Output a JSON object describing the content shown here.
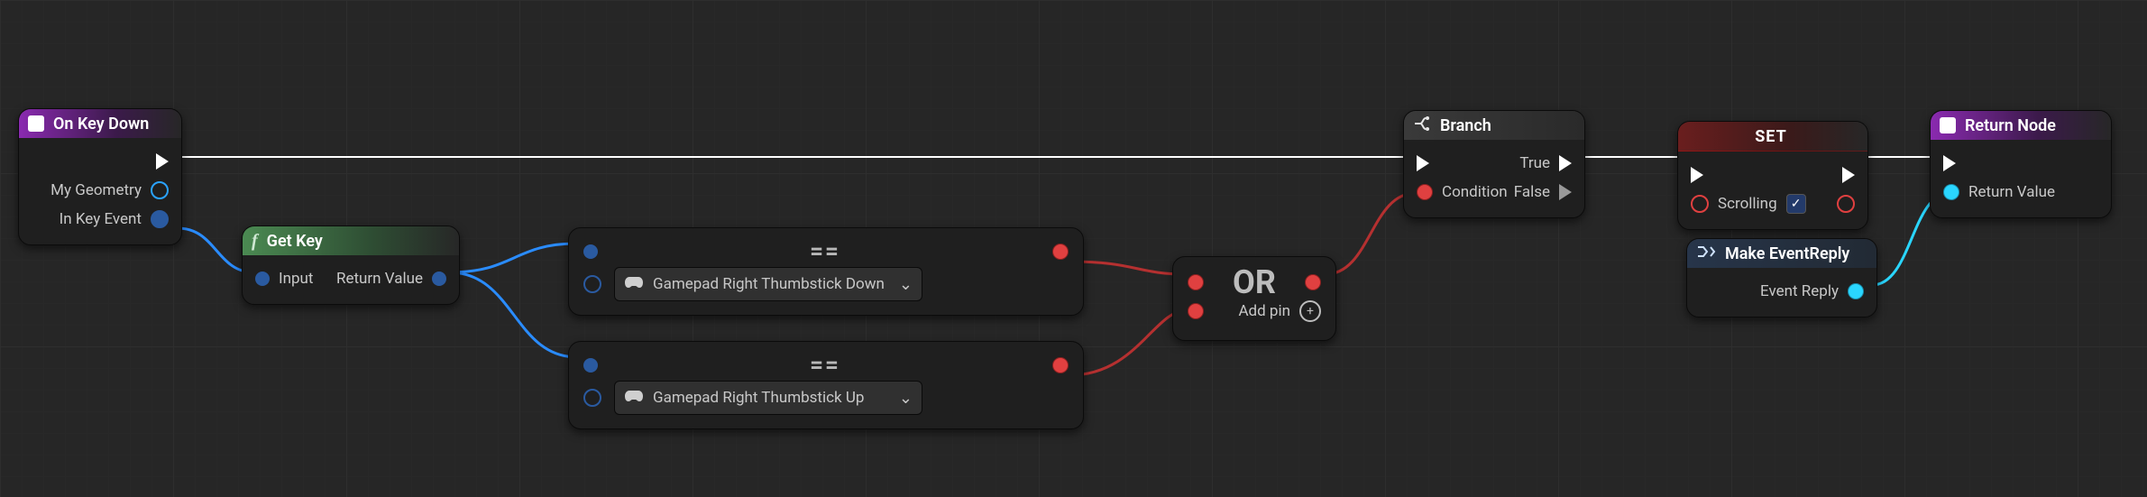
{
  "nodes": {
    "event": {
      "title": "On Key Down",
      "pins": {
        "my_geometry": "My Geometry",
        "in_key_event": "In Key Event"
      }
    },
    "getkey": {
      "title": "Get Key",
      "pins": {
        "input": "Input",
        "return": "Return Value"
      }
    },
    "eq1": {
      "op": "==",
      "select_value": "Gamepad Right Thumbstick Down"
    },
    "eq2": {
      "op": "==",
      "select_value": "Gamepad Right Thumbstick Up"
    },
    "or": {
      "op": "OR",
      "add_pin": "Add pin"
    },
    "branch": {
      "title": "Branch",
      "pins": {
        "condition": "Condition",
        "true": "True",
        "false": "False"
      }
    },
    "set": {
      "title": "SET",
      "field": "Scrolling",
      "checked": true
    },
    "make_reply": {
      "title": "Make EventReply",
      "pins": {
        "out": "Event Reply"
      }
    },
    "return": {
      "title": "Return Node",
      "pins": {
        "return_value": "Return Value"
      }
    }
  },
  "colors": {
    "exec": "#ffffff",
    "bool": "#e04040",
    "struct_key": "#2aa2ff",
    "struct_reply": "#2ad6ff"
  }
}
